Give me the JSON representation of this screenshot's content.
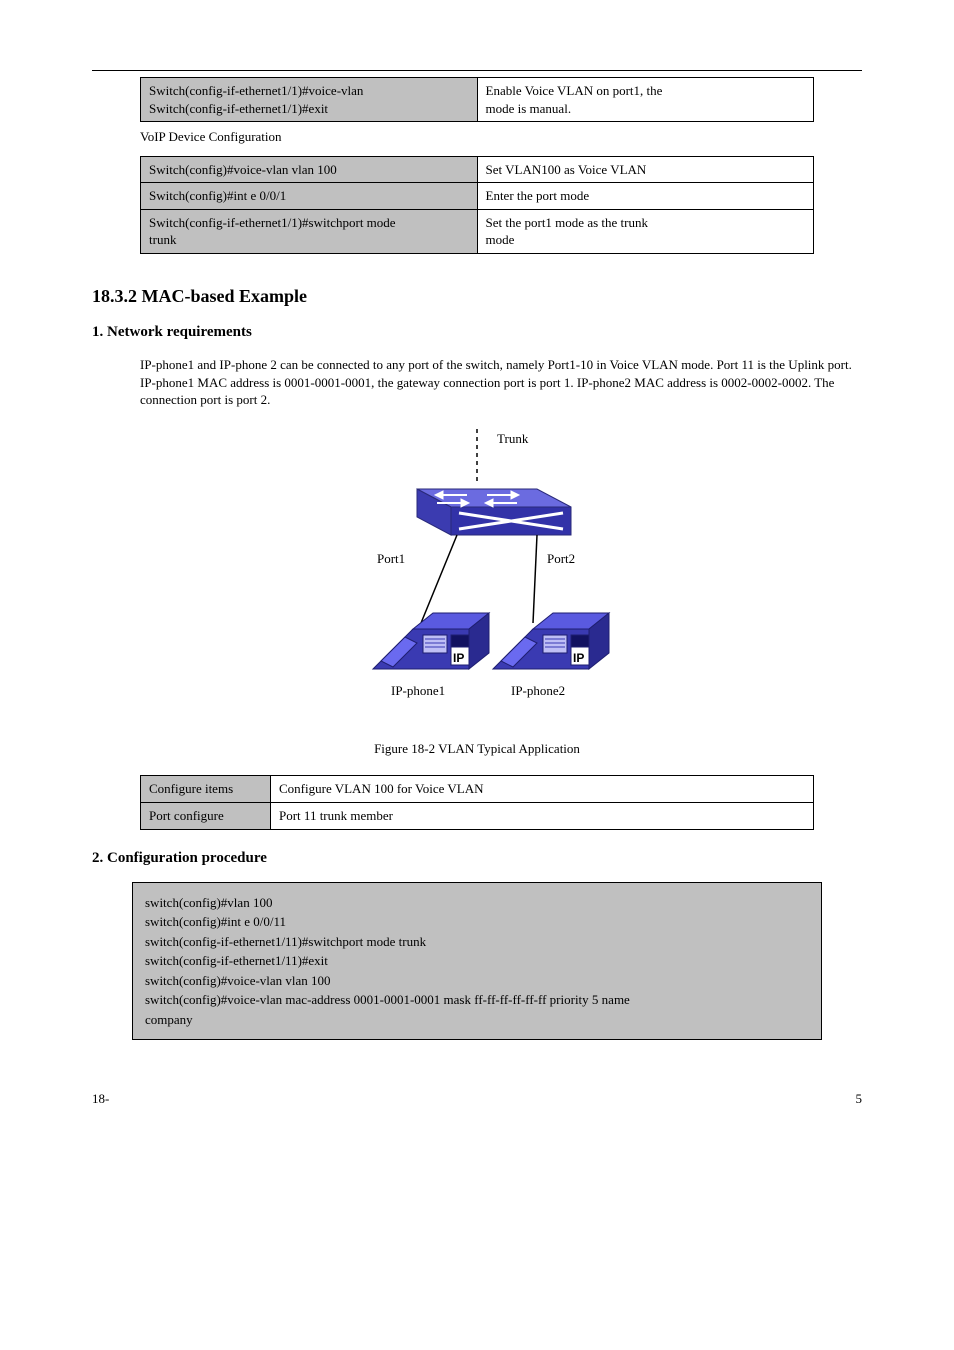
{
  "table1": {
    "left_lines": [
      "Switch(config-if-ethernet1/1)#voice-vlan",
      "Switch(config-if-ethernet1/1)#exit"
    ],
    "right_lines": [
      "Enable Voice VLAN on port1, the",
      "mode is manual."
    ]
  },
  "section_note": "VoIP Device Configuration",
  "table2": {
    "rows": [
      {
        "left": "Switch(config)#voice-vlan vlan 100",
        "right": "Set VLAN100 as Voice VLAN"
      },
      {
        "left": "Switch(config)#int e 0/0/1",
        "right": "Enter the port mode"
      },
      {
        "left_lines": [
          "Switch(config-if-ethernet1/1)#switchport mode",
          "trunk"
        ],
        "right_lines": [
          "Set the port1 mode as the trunk",
          "mode"
        ]
      }
    ]
  },
  "heading": "18.3.2  MAC-based Example",
  "sub": "1. Network requirements",
  "para": "IP-phone1 and IP-phone 2 can be connected to any port of the switch, namely Port1-10 in Voice VLAN mode. Port 11 is the Uplink port. IP-phone1 MAC address is 0001-0001-0001, the gateway connection port is port 1. IP-phone2 MAC address is 0002-0002-0002. The connection port is port 2.",
  "diagram": {
    "trunk_label": "Trunk",
    "port_labels": [
      "Port1",
      "Port2"
    ],
    "phone_labels": [
      "IP-phone1",
      "IP-phone2"
    ],
    "phone_badge": "IP"
  },
  "figure_caption": "Figure 18-2 VLAN Typical Application",
  "table3": {
    "rows": [
      {
        "left": "Configure items",
        "right": "Configure VLAN 100 for Voice VLAN"
      },
      {
        "left": "Port configure",
        "right": "Port 11 trunk member"
      }
    ]
  },
  "sub2": "2. Configuration procedure",
  "code_lines": [
    "switch(config)#vlan 100",
    "switch(config)#int e 0/0/11",
    "switch(config-if-ethernet1/11)#switchport mode trunk",
    "switch(config-if-ethernet1/11)#exit",
    "switch(config)#voice-vlan vlan 100",
    "switch(config)#voice-vlan mac-address 0001-0001-0001 mask ff-ff-ff-ff-ff-ff priority 5 name",
    "company"
  ],
  "footer": {
    "left": "18-",
    "right": "5"
  }
}
